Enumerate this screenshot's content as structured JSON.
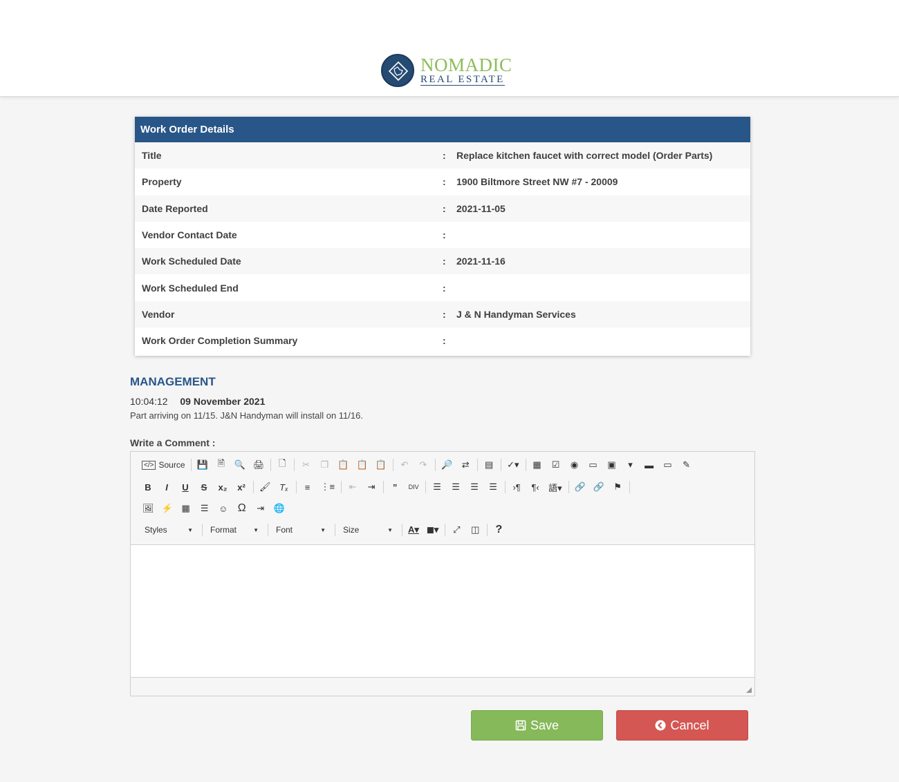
{
  "brand": {
    "name_line1": "NOMADIC",
    "name_line2": "REAL ESTATE"
  },
  "work_order": {
    "header": "Work Order Details",
    "separator": ":",
    "rows": [
      {
        "label": "Title",
        "value": "Replace kitchen faucet with correct model (Order Parts)"
      },
      {
        "label": "Property",
        "value": "1900 Biltmore Street NW #7 - 20009"
      },
      {
        "label": "Date Reported",
        "value": "2021-11-05"
      },
      {
        "label": "Vendor Contact Date",
        "value": ""
      },
      {
        "label": "Work Scheduled Date",
        "value": "2021-11-16"
      },
      {
        "label": "Work Scheduled End",
        "value": ""
      },
      {
        "label": "Vendor",
        "value": "J & N Handyman Services"
      },
      {
        "label": "Work Order Completion Summary",
        "value": ""
      }
    ]
  },
  "management": {
    "title": "MANAGEMENT",
    "time": "10:04:12",
    "date": "09 November 2021",
    "text": "Part arriving on 11/15.  J&N Handyman will install on 11/16."
  },
  "comment": {
    "label": "Write a Comment :",
    "toolbar": {
      "source_label": "Source",
      "styles_label": "Styles",
      "format_label": "Format",
      "font_label": "Font",
      "size_label": "Size"
    },
    "editor_value": ""
  },
  "buttons": {
    "save": "Save",
    "cancel": "Cancel"
  },
  "colors": {
    "primary": "#285688",
    "save": "#86b95a",
    "cancel": "#d45753",
    "logo_green": "#8bbd5a"
  }
}
